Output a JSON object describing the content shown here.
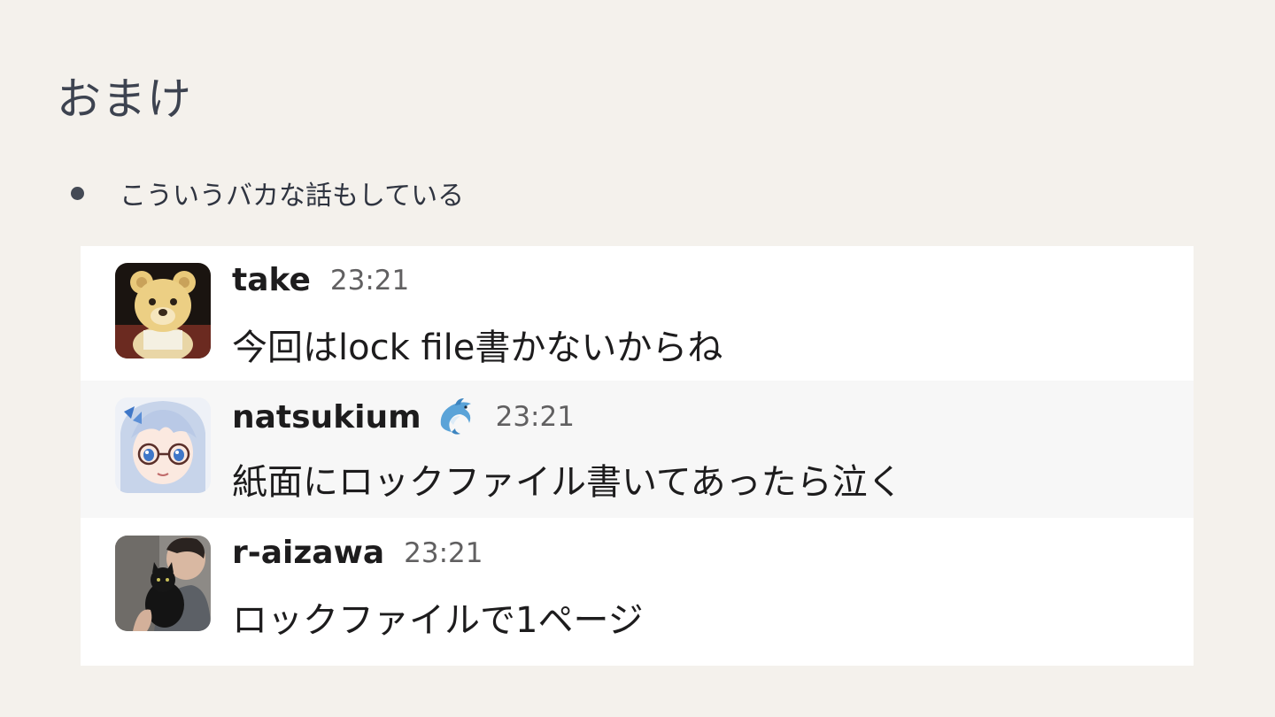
{
  "slide": {
    "title": "おまけ",
    "bullet": "こういうバカな話もしている"
  },
  "chat": {
    "messages": [
      {
        "author": "take",
        "time": "23:21",
        "text": "今回はlock file書かないからね",
        "avatar": "teddy-bear-avatar"
      },
      {
        "author": "natsukium",
        "status_emoji": "dolphin-icon",
        "time": "23:21",
        "text": "紙面にロックファイル書いてあったら泣く",
        "avatar": "anime-girl-avatar"
      },
      {
        "author": "r-aizawa",
        "time": "23:21",
        "text": "ロックファイルで1ページ",
        "avatar": "person-with-cat-avatar"
      }
    ]
  },
  "colors": {
    "slide_background": "#f4f1ec",
    "panel_background": "#ffffff",
    "highlight_row": "#f7f7f7",
    "author_text": "#1d1c1d",
    "timestamp_text": "#616061"
  }
}
